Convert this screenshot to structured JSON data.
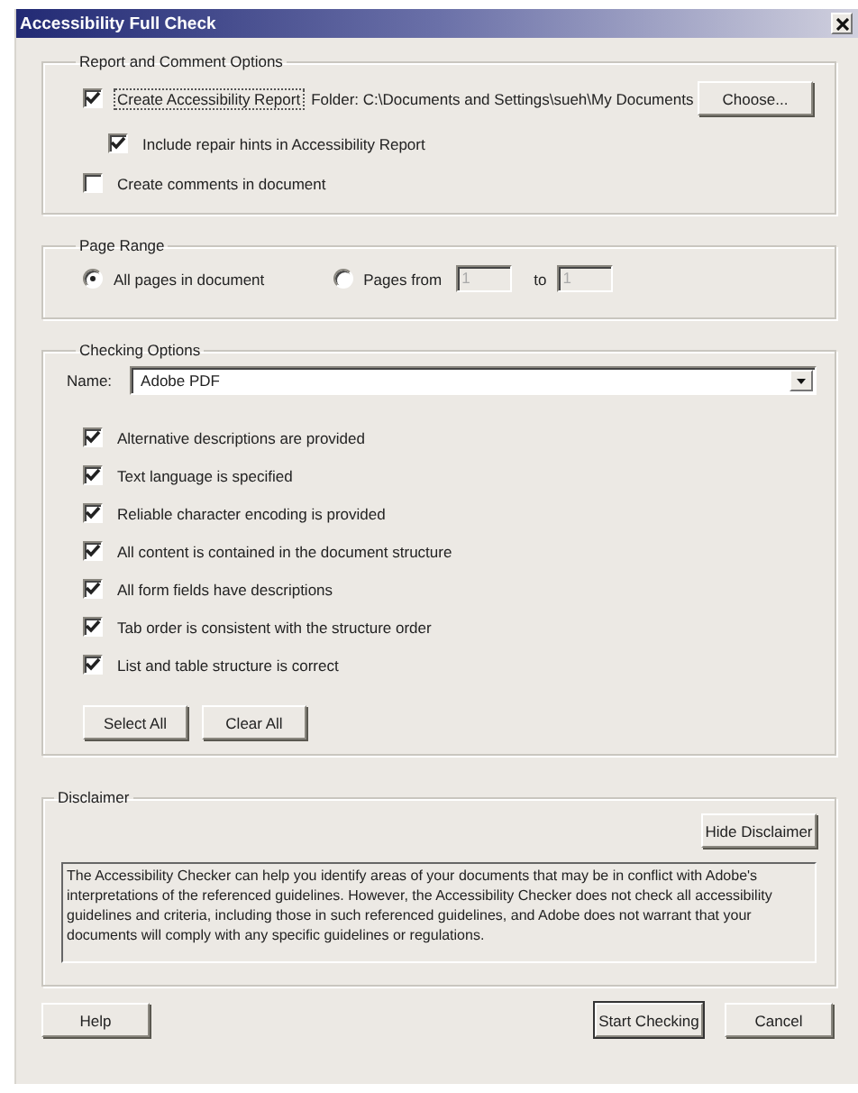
{
  "window": {
    "title": "Accessibility Full Check"
  },
  "report_options": {
    "title": "Report and Comment Options",
    "items": [
      {
        "label": "Create Accessibility Report",
        "checked": true,
        "focused": true,
        "children": [
          {
            "label": "Include repair hints in Accessibility Report",
            "checked": true,
            "focused": false
          }
        ]
      },
      {
        "label": "Create comments in document",
        "checked": false,
        "focused": false
      }
    ],
    "folder": "Folder: C:\\Documents and Settings\\sueh\\My Documents",
    "choose_button": "Choose..."
  },
  "page_range": {
    "title": "Page Range",
    "options": [
      {
        "label": "All pages in document",
        "selected": true
      },
      {
        "label": "Pages from",
        "selected": false
      }
    ],
    "from": {
      "value": "1",
      "disabled": true
    },
    "to_label": "to",
    "to": {
      "value": "1",
      "disabled": true
    }
  },
  "checking_options": {
    "title": "Checking Options",
    "name_label": "Name:",
    "name_value": "Adobe PDF",
    "checks": [
      {
        "label": "Alternative descriptions are provided",
        "checked": true
      },
      {
        "label": "Text language is specified",
        "checked": true
      },
      {
        "label": "Reliable character encoding is provided",
        "checked": true
      },
      {
        "label": "All content is contained in the document structure",
        "checked": true
      },
      {
        "label": "All form fields have descriptions",
        "checked": true
      },
      {
        "label": "Tab order is consistent with the structure order",
        "checked": true
      },
      {
        "label": "List and table structure is correct",
        "checked": true
      }
    ],
    "buttons": [
      "Select All",
      "Clear All"
    ]
  },
  "disclaimer": {
    "title": "Disclaimer",
    "hide_button": "Hide Disclaimer",
    "text": "The Accessibility Checker can help you identify areas of your documents that may be in conflict with Adobe's interpretations of the referenced guidelines. However, the Accessibility Checker does not check all accessibility guidelines and criteria, including those in such referenced guidelines, and Adobe does not warrant that your documents will comply with any specific guidelines or regulations."
  },
  "footer": {
    "buttons": [
      {
        "label": "Help",
        "default": false
      },
      {
        "label": "Start Checking",
        "default": true
      },
      {
        "label": "Cancel",
        "default": false
      }
    ]
  }
}
